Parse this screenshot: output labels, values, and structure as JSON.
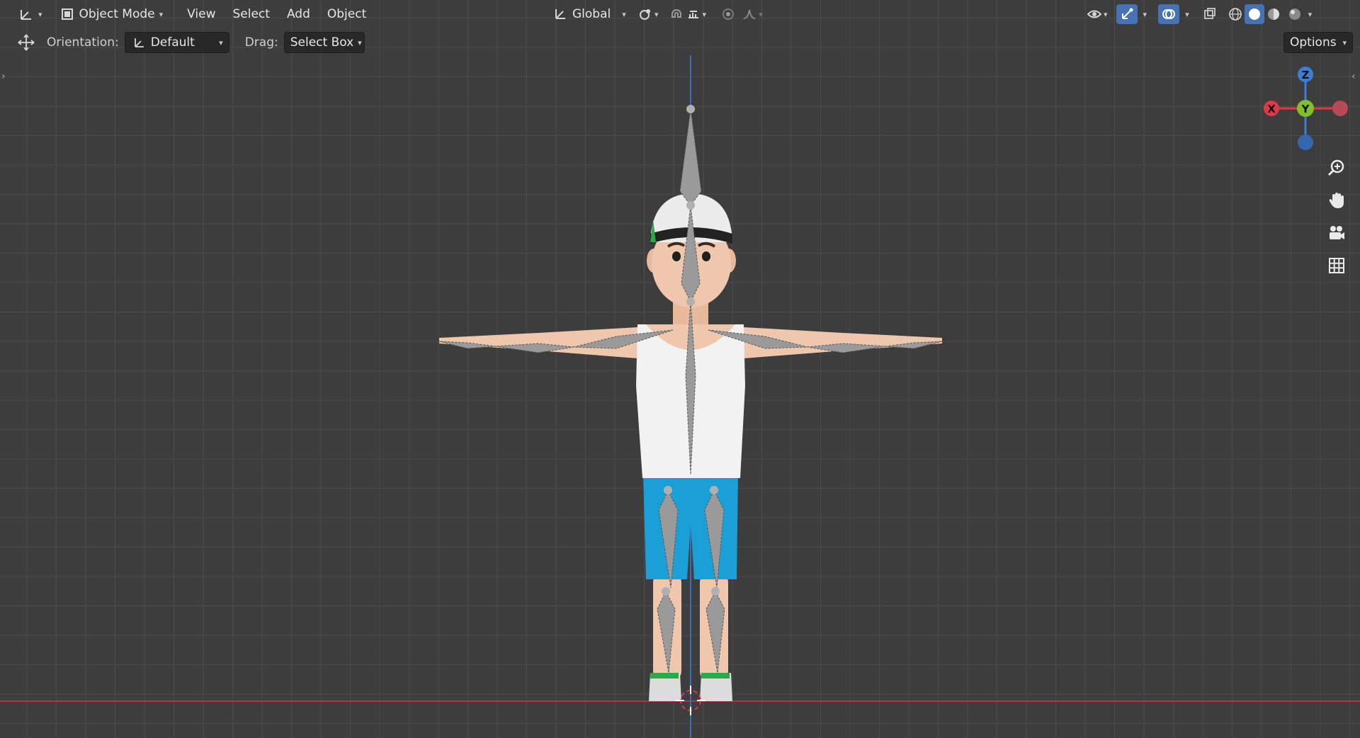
{
  "header": {
    "mode": "Object Mode",
    "menus": [
      "View",
      "Select",
      "Add",
      "Object"
    ],
    "transform_orientation": "Global"
  },
  "toolbar": {
    "orientation_label": "Orientation:",
    "orientation_value": "Default",
    "drag_label": "Drag:",
    "drag_value": "Select Box",
    "options_label": "Options"
  },
  "gizmo": {
    "z": "Z",
    "y": "Y",
    "x": "X"
  },
  "colors": {
    "axis_x": "#e0384b",
    "axis_y": "#7fbf2a",
    "axis_z": "#3d7dd8",
    "accent": "#4772b3",
    "cap_stripe": "#2ea84a",
    "shorts": "#1aa0d6"
  }
}
